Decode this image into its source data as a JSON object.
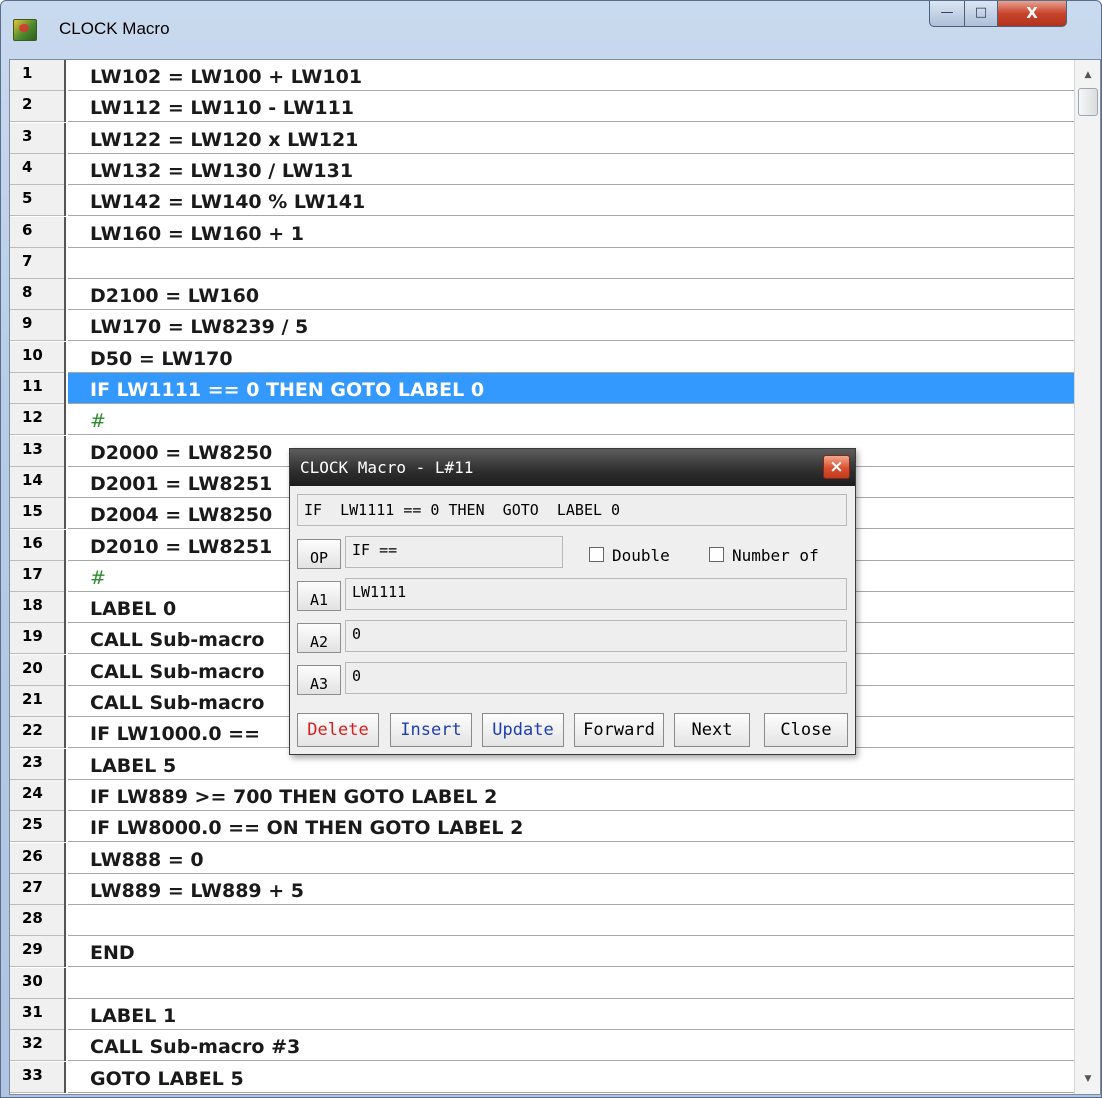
{
  "window": {
    "title": "CLOCK Macro",
    "controls": {
      "minimize": "—",
      "maximize": "□",
      "close": "X"
    }
  },
  "lines": [
    {
      "num": "1",
      "text": "LW102 = LW100 + LW101"
    },
    {
      "num": "2",
      "text": "LW112 = LW110 - LW111"
    },
    {
      "num": "3",
      "text": "LW122 = LW120 x LW121"
    },
    {
      "num": "4",
      "text": "LW132 = LW130 / LW131"
    },
    {
      "num": "5",
      "text": "LW142 = LW140 % LW141"
    },
    {
      "num": "6",
      "text": "LW160 = LW160 + 1"
    },
    {
      "num": "7",
      "text": ""
    },
    {
      "num": "8",
      "text": "D2100 = LW160"
    },
    {
      "num": "9",
      "text": "LW170 = LW8239 / 5"
    },
    {
      "num": "10",
      "text": "D50 = LW170"
    },
    {
      "num": "11",
      "text": "IF LW1111 == 0 THEN  GOTO  LABEL 0",
      "selected": true
    },
    {
      "num": "12",
      "text": "#",
      "comment": true
    },
    {
      "num": "13",
      "text": "D2000 = LW8250"
    },
    {
      "num": "14",
      "text": "D2001 = LW8251"
    },
    {
      "num": "15",
      "text": "D2004 = LW8250"
    },
    {
      "num": "16",
      "text": "D2010 = LW8251"
    },
    {
      "num": "17",
      "text": "#",
      "comment": true
    },
    {
      "num": "18",
      "text": "LABEL  0"
    },
    {
      "num": "19",
      "text": "CALL  Sub-macro"
    },
    {
      "num": "20",
      "text": "CALL  Sub-macro"
    },
    {
      "num": "21",
      "text": "CALL  Sub-macro"
    },
    {
      "num": "22",
      "text": "IF LW1000.0 =="
    },
    {
      "num": "23",
      "text": "LABEL  5"
    },
    {
      "num": "24",
      "text": "IF  LW889 >= 700 THEN  GOTO  LABEL 2"
    },
    {
      "num": "25",
      "text": "IF LW8000.0 == ON  THEN  GOTO  LABEL 2"
    },
    {
      "num": "26",
      "text": "LW888 = 0"
    },
    {
      "num": "27",
      "text": "LW889 = LW889 + 5"
    },
    {
      "num": "28",
      "text": ""
    },
    {
      "num": "29",
      "text": "END"
    },
    {
      "num": "30",
      "text": ""
    },
    {
      "num": "31",
      "text": "LABEL  1"
    },
    {
      "num": "32",
      "text": "CALL  Sub-macro #3"
    },
    {
      "num": "33",
      "text": "GOTO  LABEL  5"
    }
  ],
  "dialog": {
    "title": "CLOCK Macro - L#11",
    "close": "×",
    "statement": "IF  LW1111 == 0 THEN  GOTO  LABEL 0",
    "op": {
      "label": "OP",
      "value": "IF =="
    },
    "a1": {
      "label": "A1",
      "value": "LW1111"
    },
    "a2": {
      "label": "A2",
      "value": "0"
    },
    "a3": {
      "label": "A3",
      "value": "0"
    },
    "checkboxes": {
      "double": "Double",
      "number_of": "Number of"
    },
    "buttons": {
      "delete": "Delete",
      "insert": "Insert",
      "update": "Update",
      "forward": "Forward",
      "next": "Next",
      "close": "Close"
    },
    "colors": {
      "delete": "#d81f1f",
      "insert": "#1d3fb0",
      "update": "#1d3fb0",
      "normal": "#000000"
    }
  },
  "colors": {
    "selection": "#3399ff",
    "comment": "#2e8b2e"
  }
}
